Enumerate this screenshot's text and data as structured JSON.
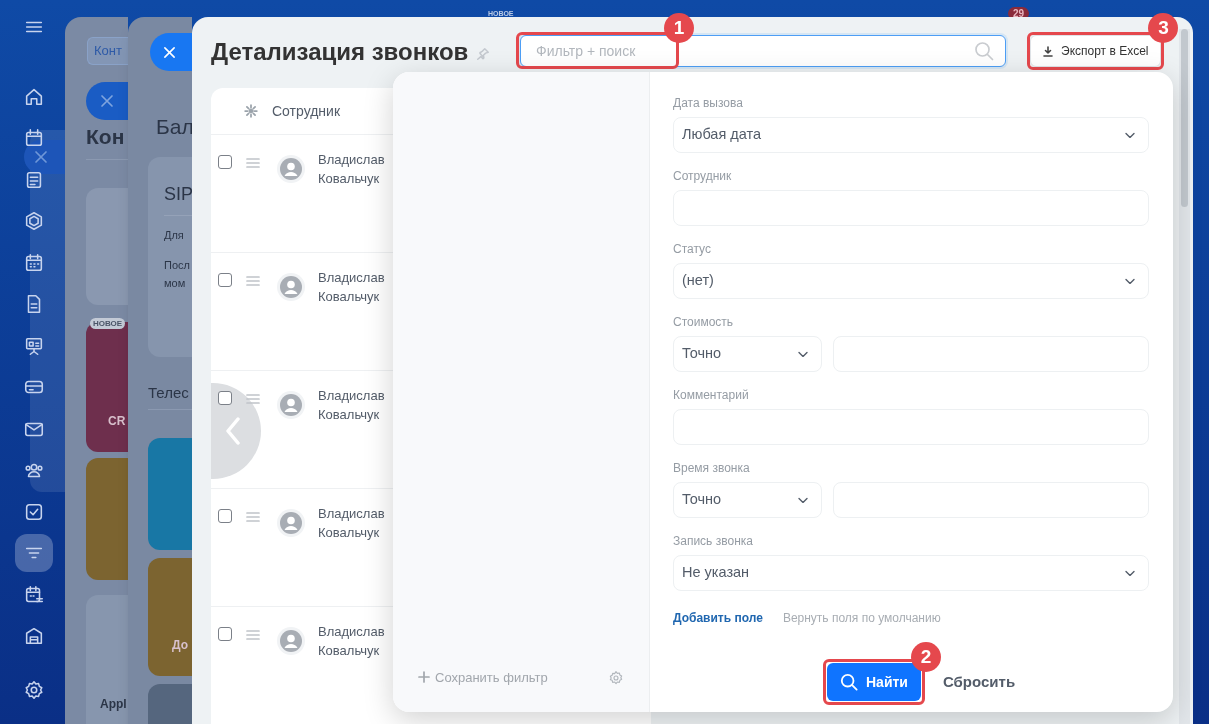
{
  "top_strip": {
    "badge": "НОВОЕ",
    "counter": "29"
  },
  "sidebar": {
    "items": [
      {
        "selected": false
      },
      {
        "selected": false
      },
      {
        "selected": false
      },
      {
        "selected": false
      },
      {
        "selected": false
      },
      {
        "selected": false
      },
      {
        "selected": false
      },
      {
        "selected": false
      },
      {
        "selected": false
      },
      {
        "selected": false
      },
      {
        "selected": false
      },
      {
        "selected": false
      },
      {
        "selected": true
      },
      {
        "selected": false
      },
      {
        "selected": false
      },
      {
        "selected": false
      }
    ]
  },
  "panel_1": {
    "tab": "Конт",
    "heading": "Кон",
    "cards": [
      {
        "color": "#8a98b0"
      },
      {
        "label": "CR",
        "badge": "НОВОЕ",
        "color": "#6e2f4d"
      },
      {
        "color": "#7c6430"
      },
      {
        "label": "Appl",
        "color": "#8796ae"
      }
    ]
  },
  "panel_2": {
    "heading": "Бал",
    "sip_card": {
      "title": "SIP",
      "lines": [
        "Для",
        "Посл",
        "мом"
      ]
    },
    "section": "Телес",
    "cards": [
      {
        "color": "#1877a5"
      },
      {
        "label": "До",
        "color": "#7c6430"
      },
      {
        "color": "#55667e"
      }
    ]
  },
  "main": {
    "title": "Детализация звонков",
    "search": {
      "placeholder": "Фильтр + поиск",
      "callout": "1"
    },
    "export": {
      "label": "Экспорт в Excel",
      "callout": "3"
    },
    "table": {
      "columns": [
        "Сотрудник"
      ],
      "rows": [
        {
          "checked": false,
          "name": "Владислав Ковальчук"
        },
        {
          "checked": false,
          "name": "Владислав Ковальчук"
        },
        {
          "checked": false,
          "name": "Владислав Ковальчук"
        },
        {
          "checked": false,
          "name": "Владислав Ковальчук"
        },
        {
          "checked": false,
          "name": "Владислав Ковальчук"
        }
      ]
    },
    "filter": {
      "save_filter": "Сохранить фильтр",
      "fields": [
        {
          "label": "Дата вызова",
          "kind": "select",
          "value": "Любая дата"
        },
        {
          "label": "Сотрудник",
          "kind": "input"
        },
        {
          "label": "Статус",
          "kind": "select",
          "value": "(нет)"
        },
        {
          "label": "Стоимость",
          "kind": "range",
          "value": "Точно"
        },
        {
          "label": "Комментарий",
          "kind": "input"
        },
        {
          "label": "Время звонка",
          "kind": "range",
          "value": "Точно"
        },
        {
          "label": "Запись звонка",
          "kind": "select",
          "value": "Не указан"
        }
      ],
      "add_field": "Добавить поле",
      "restore": "Вернуть поля по умолчанию",
      "find": {
        "label": "Найти",
        "callout": "2"
      },
      "reset": "Сбросить"
    }
  }
}
